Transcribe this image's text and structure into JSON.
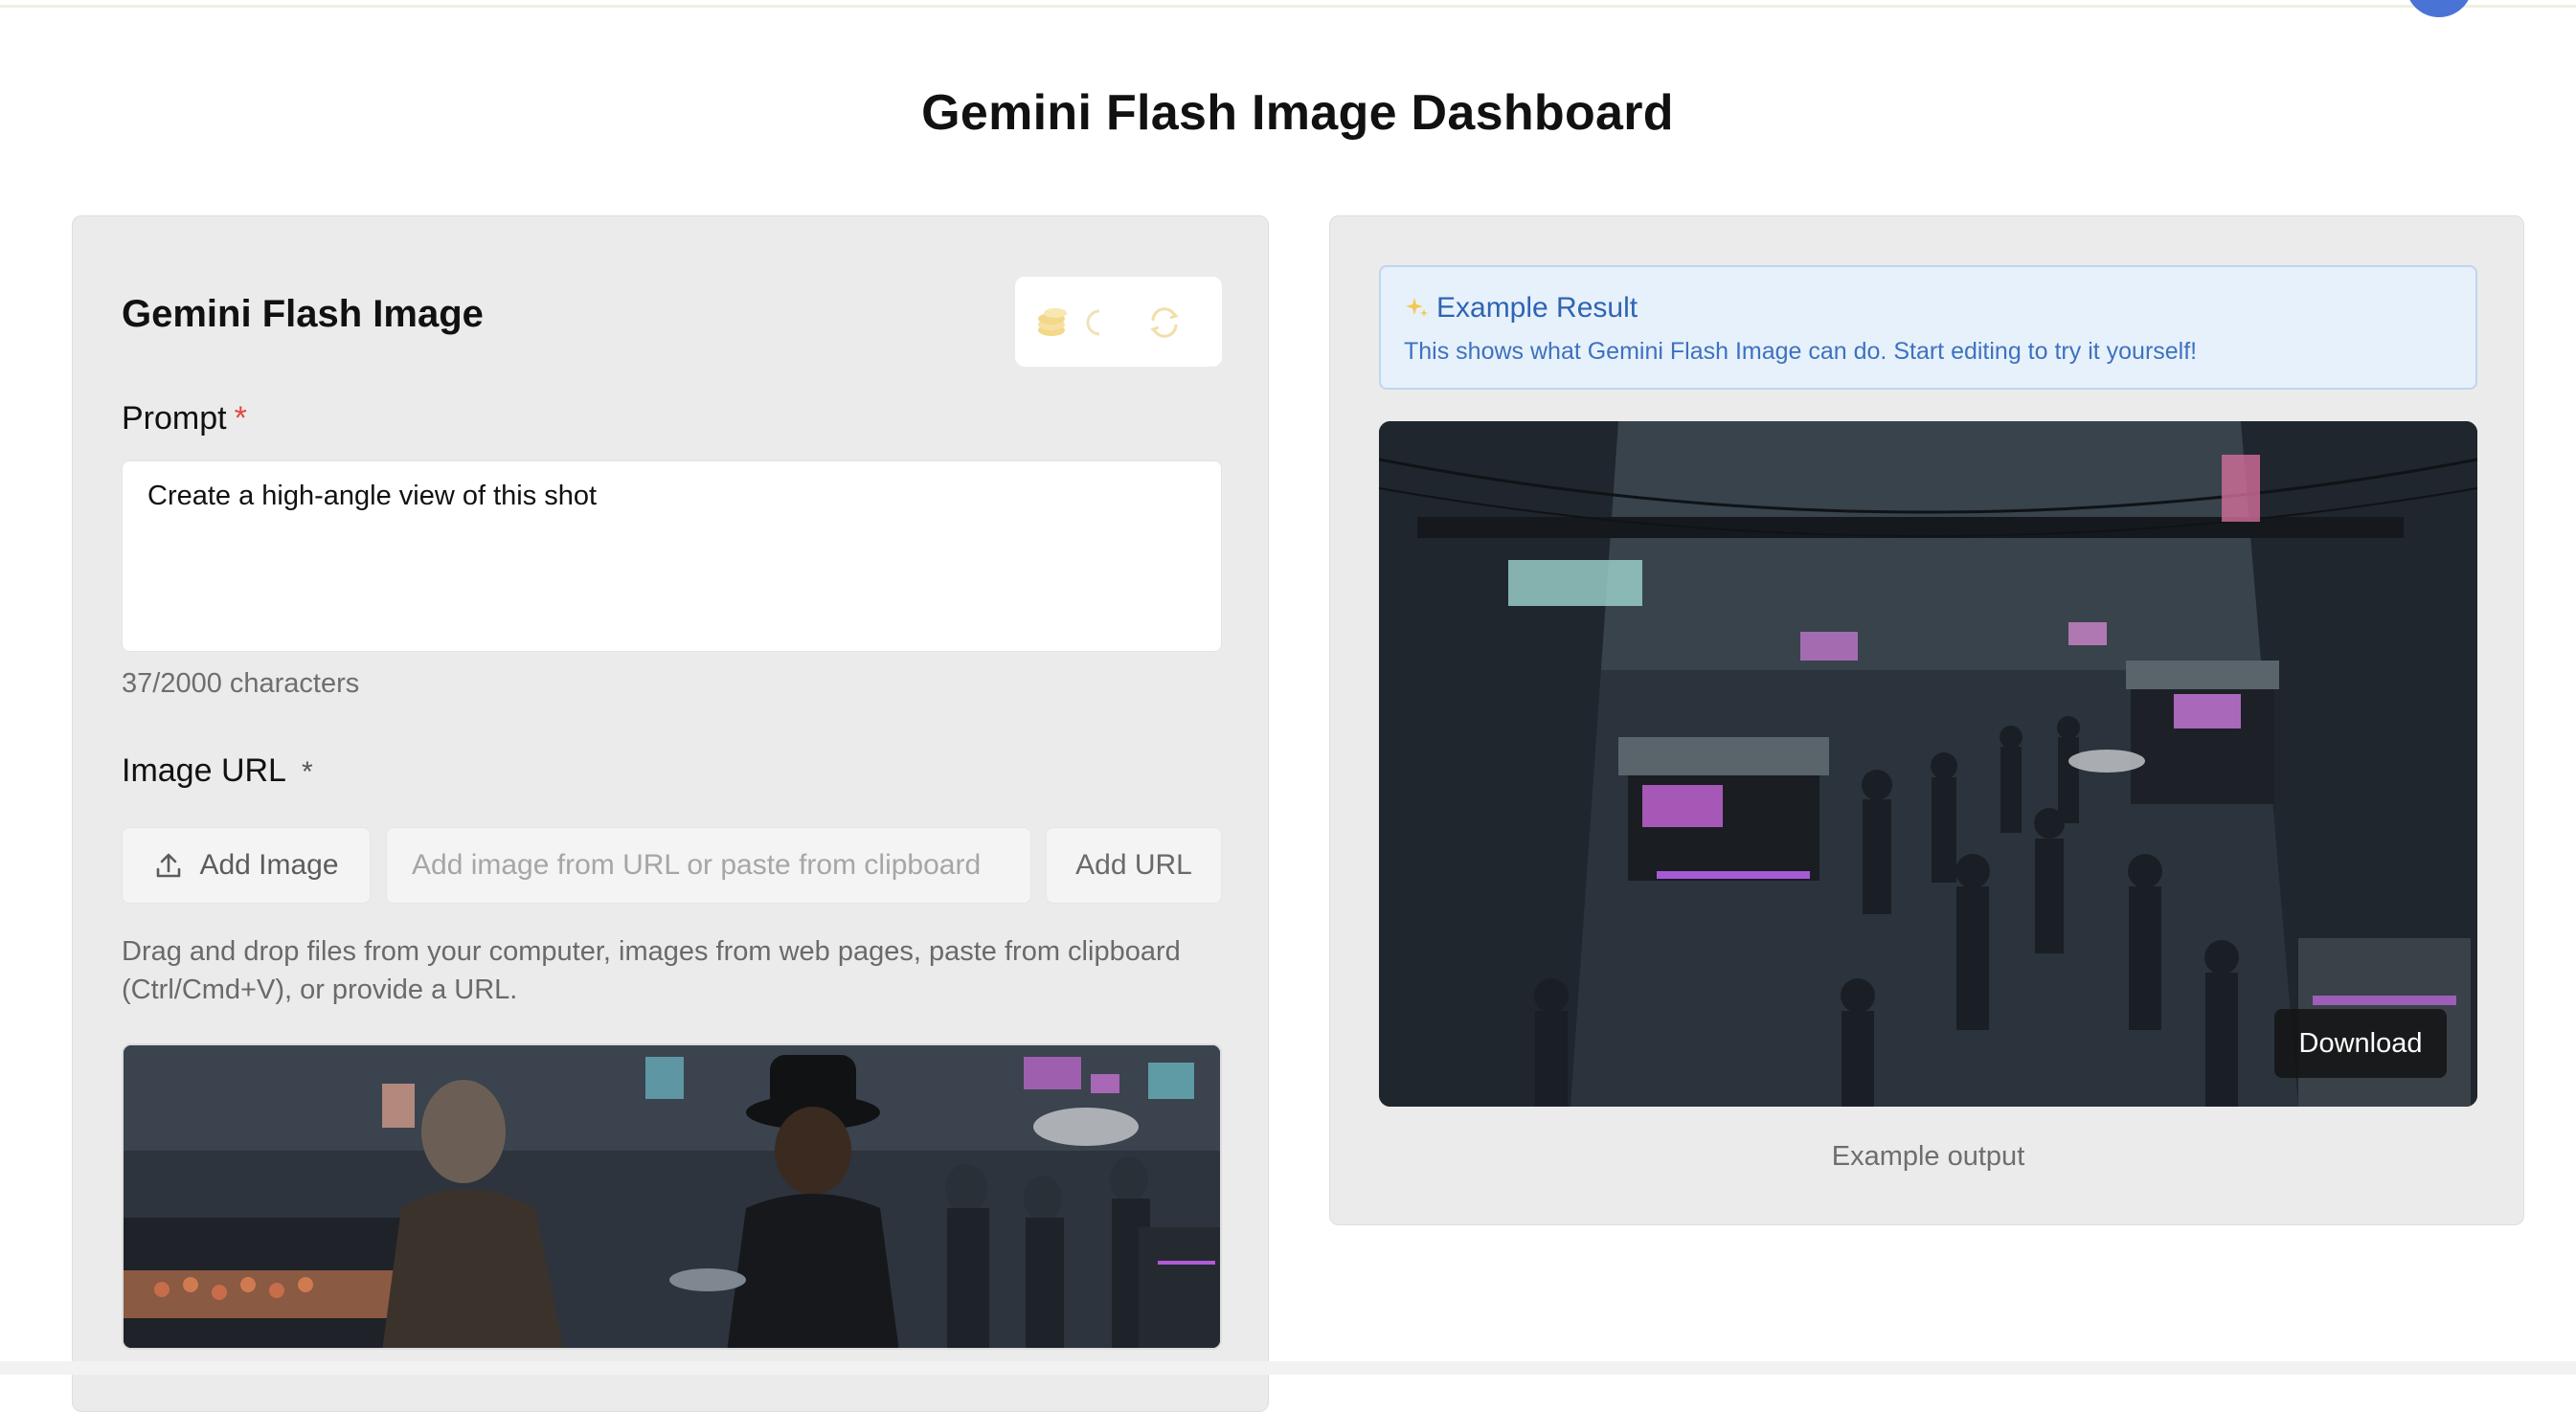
{
  "page": {
    "title": "Gemini Flash Image Dashboard"
  },
  "form": {
    "title": "Gemini Flash Image",
    "prompt": {
      "label": "Prompt",
      "required_mark": "*",
      "value": "Create a high-angle view of this shot",
      "char_count": "37/2000 characters"
    },
    "image_url": {
      "label": "Image URL",
      "required_mark": "*",
      "add_image_label": "Add Image",
      "url_placeholder": "Add image from URL or paste from clipboard",
      "add_url_label": "Add URL",
      "helper_text": "Drag and drop files from your computer, images from web pages, paste from clipboard (Ctrl/Cmd+V), or provide a URL."
    },
    "tool_icons": [
      "coins-icon",
      "moon-icon",
      "refresh-icon"
    ]
  },
  "result": {
    "banner_title": "Example Result",
    "banner_subtitle": "This shows what Gemini Flash Image can do. Start editing to try it yourself!",
    "download_label": "Download",
    "caption": "Example output"
  },
  "colors": {
    "accent_blue": "#2f64b3",
    "banner_bg": "#e7f1fb",
    "required_red": "#e0483e",
    "panel_bg": "#ebebeb"
  }
}
